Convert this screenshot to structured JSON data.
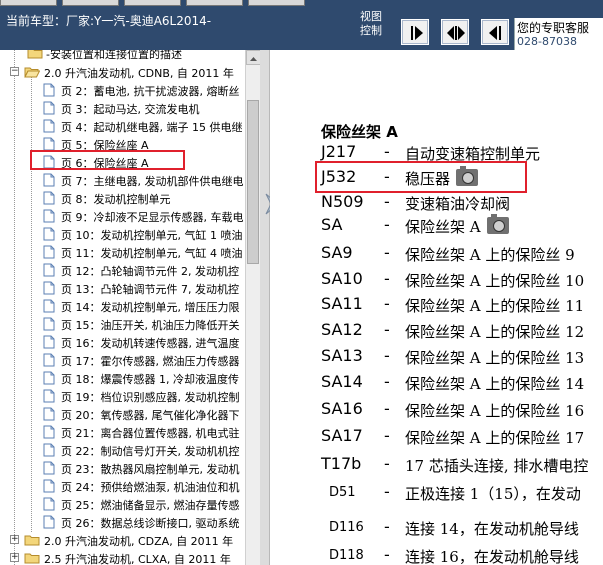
{
  "header": {
    "car_label": "当前车型：厂家:Y一汽-奥迪A6L2014-",
    "view_label": "视图控制",
    "service_label": "您的专职客服",
    "phone_label": "028-87038",
    "buttons": [
      {
        "name": "nav-forward",
        "icon": "arrow-right-icon"
      },
      {
        "name": "nav-bidirectional",
        "icon": "arrow-both-icon"
      },
      {
        "name": "nav-back",
        "icon": "arrow-left-icon"
      }
    ]
  },
  "tree": {
    "top_item": "-安装位置和连接位置的描述",
    "group_current": "2.0 升汽油发动机, CDNB, 自 2011 年",
    "pages": [
      "页 2：蓄电池, 抗干扰滤波器, 熔断丝",
      "页 3：起动马达, 交流发电机",
      "页 4：起动机继电器, 端子 15 供电继",
      "页 5：保险丝座 A",
      "页 6：保险丝座 A",
      "页 7：主继电器, 发动机部件供电继电",
      "页 8：发动机控制单元",
      "页 9：冷却液不足显示传感器, 车载电",
      "页 10：发动机控制单元, 气缸 1 喷油",
      "页 11：发动机控制单元, 气缸 4 喷油",
      "页 12：凸轮轴调节元件 2, 发动机控",
      "页 13：凸轮轴调节元件 7, 发动机控",
      "页 14：发动机控制单元, 增压压力限",
      "页 15：油压开关, 机油压力降低开关",
      "页 16：发动机转速传感器, 进气温度",
      "页 17：霍尔传感器, 燃油压力传感器",
      "页 18：爆震传感器 1, 冷却液温度传",
      "页 19：档位识别感应器, 发动机控制",
      "页 20：氧传感器, 尾气催化净化器下",
      "页 21：离合器位置传感器, 机电式驻",
      "页 22：制动信号灯开关, 发动机机控",
      "页 23：散热器风扇控制单元, 发动机",
      "页 24：预供给燃油泵, 机油油位和机",
      "页 25：燃油储备显示, 燃油存量传感",
      "页 26：数据总线诊断接口, 驱动系统"
    ],
    "group_next_1": "2.0 升汽油发动机, CDZA, 自 2011 年",
    "group_next_2": "2.5 升汽油发动机, CLXA, 自 2011 年"
  },
  "doc": {
    "title": "保险丝架 A",
    "rows": [
      {
        "code": "J217",
        "desc": "自动变速箱控制单元",
        "camera": false
      },
      {
        "code": "J532",
        "desc": "稳压器",
        "camera": true
      },
      {
        "code": "N509",
        "desc": "变速箱油冷却阀",
        "camera": false
      },
      {
        "code": "SA",
        "desc": "保险丝架 A",
        "camera": true
      },
      {
        "code": "SA9",
        "desc": "保险丝架 A 上的保险丝 9",
        "camera": false
      },
      {
        "code": "SA10",
        "desc": "保险丝架 A 上的保险丝 10",
        "camera": false
      },
      {
        "code": "SA11",
        "desc": "保险丝架 A 上的保险丝 11",
        "camera": false
      },
      {
        "code": "SA12",
        "desc": "保险丝架 A 上的保险丝 12",
        "camera": false
      },
      {
        "code": "SA13",
        "desc": "保险丝架 A 上的保险丝 13",
        "camera": false
      },
      {
        "code": "SA14",
        "desc": "保险丝架 A 上的保险丝 14",
        "camera": false
      },
      {
        "code": "SA16",
        "desc": "保险丝架 A 上的保险丝 16",
        "camera": false
      },
      {
        "code": "SA17",
        "desc": "保险丝架 A 上的保险丝 17",
        "camera": false
      },
      {
        "code": "T17b",
        "desc": "17 芯插头连接, 排水槽电控",
        "camera": false
      },
      {
        "code": "D51",
        "desc": "正极连接 1（15），在发动",
        "camera": false
      },
      {
        "code": "D116",
        "desc": "连接 14，在发动机舱导线",
        "camera": false
      },
      {
        "code": "D118",
        "desc": "连接 16，在发动机舱导线",
        "camera": false
      }
    ]
  },
  "colors": {
    "header_bg": "#2f4a6e",
    "highlight": "#e0202c"
  }
}
